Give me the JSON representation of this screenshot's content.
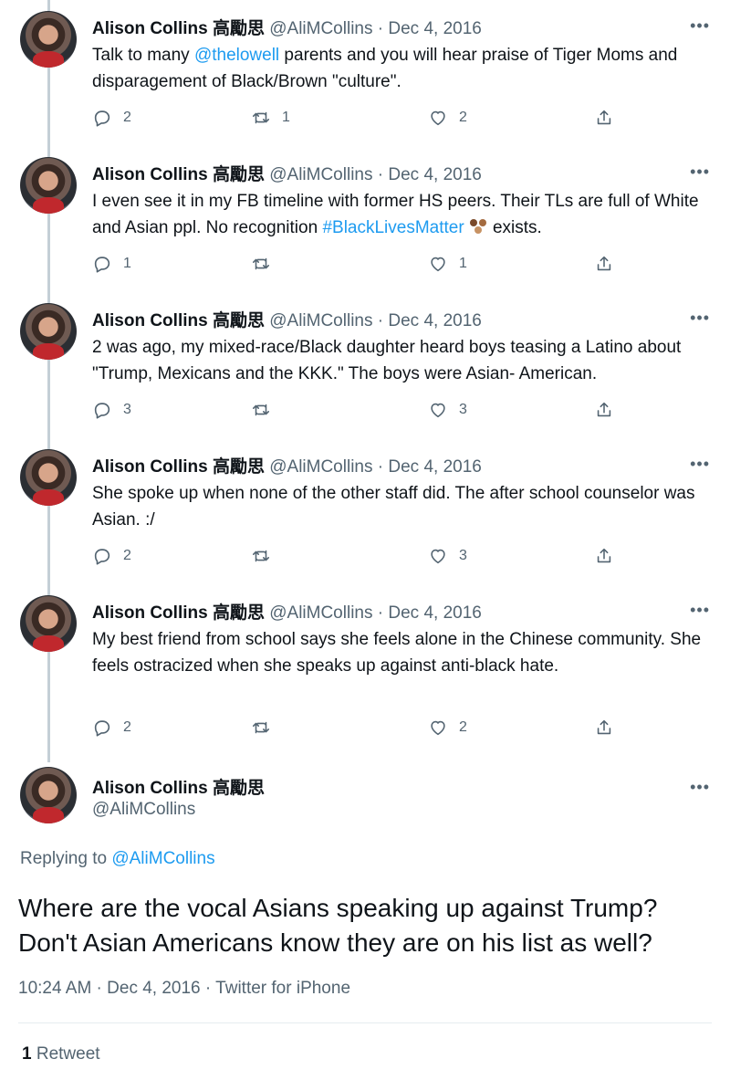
{
  "author": {
    "name": "Alison Collins 高勵思",
    "handle": "@AliMCollins"
  },
  "separator": "·",
  "more_glyph": "•••",
  "tweets": [
    {
      "date": "Dec 4, 2016",
      "text_pre": "Talk to many ",
      "mention": "@thelowell",
      "text_post": " parents and you will hear praise of Tiger Moms and disparagement of Black/Brown \"culture\".",
      "replies": "2",
      "retweets": "1",
      "likes": "2"
    },
    {
      "date": "Dec 4, 2016",
      "text_pre": "I even see it in my FB timeline with former HS peers. Their TLs are full of White and Asian ppl. No recognition ",
      "hashtag": "#BlackLivesMatter",
      "text_post": " exists.",
      "replies": "1",
      "retweets": "",
      "likes": "1"
    },
    {
      "date": "Dec 4, 2016",
      "text": "2 was ago, my mixed-race/Black daughter heard boys teasing a Latino about \"Trump, Mexicans and the KKK.\" The boys were Asian- American.",
      "replies": "3",
      "retweets": "",
      "likes": "3"
    },
    {
      "date": "Dec 4, 2016",
      "text": "She spoke up when none of the other staff did. The after school counselor was Asian. :/",
      "replies": "2",
      "retweets": "",
      "likes": "3"
    },
    {
      "date": "Dec 4, 2016",
      "text": "My best friend from school says she feels alone in the Chinese community. She feels ostracized when she speaks up against anti-black hate.",
      "replies": "2",
      "retweets": "",
      "likes": "2"
    }
  ],
  "main": {
    "replying_prefix": "Replying to ",
    "replying_handle": "@AliMCollins",
    "text": "Where are the vocal Asians speaking up against Trump? Don't Asian Americans know they are on his list as well?",
    "meta": "10:24 AM · Dec 4, 2016 · Twitter for iPhone",
    "retweet_count": "1",
    "retweet_label": " Retweet"
  }
}
